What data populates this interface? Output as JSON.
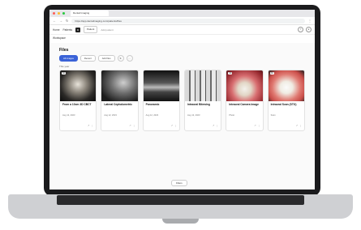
{
  "browser": {
    "tab_title": "Dental Imaging",
    "url": "https://app.dentalimaging.com/patients/files",
    "traffic_colors": [
      "#ff5f57",
      "#febc2e",
      "#28c840"
    ]
  },
  "app_header": {
    "logo_text": "D",
    "left_labels": [
      "Home",
      "Patients"
    ],
    "patient_tab": "Patient",
    "secondary_tab": "Add patient"
  },
  "workspace": {
    "label": "Workspace"
  },
  "main": {
    "title": "Files",
    "filters": [
      "All images",
      "Recent",
      "Add files"
    ],
    "section_label": "This year",
    "bottom_button": "Filters"
  },
  "cards": [
    {
      "title": "From a 10cm 3D CBCT",
      "date": "Aug 12, 2023",
      "badge": "3D"
    },
    {
      "title": "Lateral Cephalometric",
      "date": "Aug 12, 2023",
      "badge": ""
    },
    {
      "title": "Panoramic",
      "date": "Aug 12, 2023",
      "badge": ""
    },
    {
      "title": "Intraoral Bitewing",
      "date": "Aug 12, 2023",
      "badge": ""
    },
    {
      "title": "Intraoral Camera Image",
      "date": "Photo",
      "badge": "3D"
    },
    {
      "title": "Intraoral Scan (STO)",
      "date": "Scan",
      "badge": "3D"
    }
  ],
  "colors": {
    "accent": "#3a62d7",
    "bezel": "#1b1b1d"
  }
}
